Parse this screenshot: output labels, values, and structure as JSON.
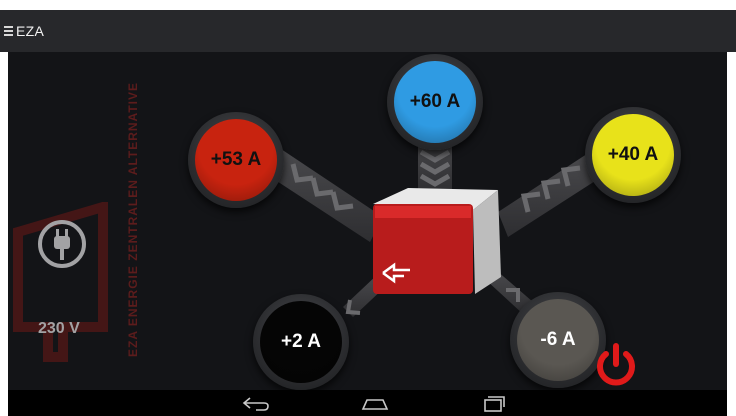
{
  "app": {
    "title": "EZA"
  },
  "source": {
    "voltage": "230 V",
    "icon": "plug-icon"
  },
  "branding": {
    "watermark": "EZA ENERGIE ZENTRALEN ALTERNATIVE",
    "logo_icon": "eza-logo-icon"
  },
  "outputs": [
    {
      "id": "top-left",
      "value": "+53 A",
      "color": "#c8230f",
      "text_color": "#111111"
    },
    {
      "id": "top",
      "value": "+60 A",
      "color": "#2f9be3",
      "text_color": "#111111"
    },
    {
      "id": "top-right",
      "value": "+40 A",
      "color": "#e8e21a",
      "text_color": "#111111"
    },
    {
      "id": "bottom-left",
      "value": "+2 A",
      "color": "#050505",
      "text_color": "#ffffff"
    },
    {
      "id": "bottom-right",
      "value": "-6 A",
      "color": "#5a5752",
      "text_color": "#ffffff"
    }
  ],
  "power_button": {
    "icon": "power-icon",
    "color": "#e01a1a"
  },
  "navbar": {
    "back": "back-icon",
    "home": "home-icon",
    "recents": "recents-icon"
  }
}
